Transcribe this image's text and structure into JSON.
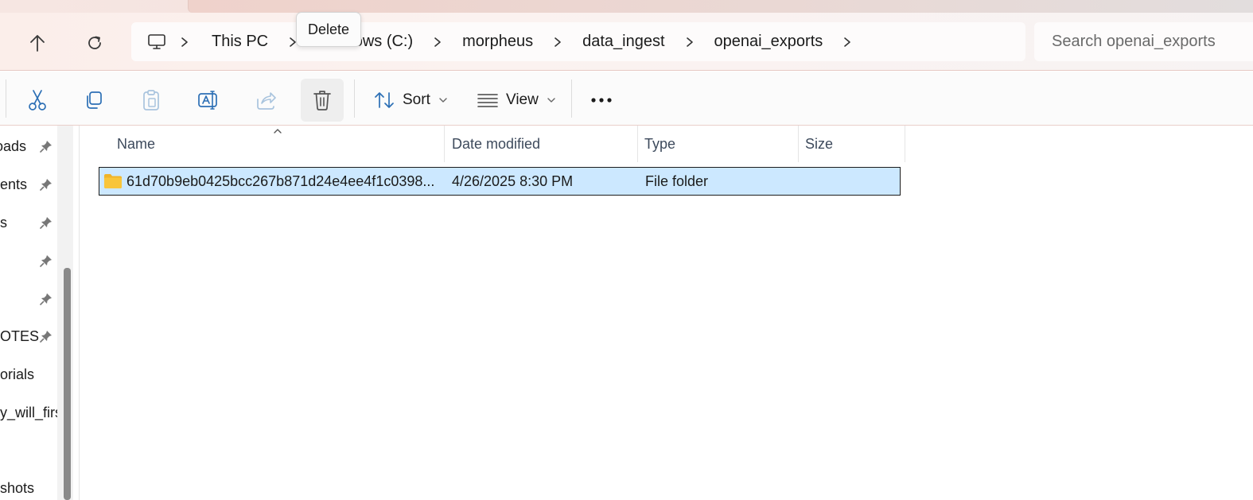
{
  "address_bar": {
    "crumbs": [
      "This PC",
      "Windows (C:)",
      "morpheus",
      "data_ingest",
      "openai_exports"
    ]
  },
  "search": {
    "placeholder": "Search openai_exports"
  },
  "tooltip": {
    "text": "Delete"
  },
  "command_bar": {
    "sort_label": "Sort",
    "view_label": "View"
  },
  "sidebar": {
    "items": [
      {
        "label": "oads",
        "pinned": true
      },
      {
        "label": "ents",
        "pinned": true
      },
      {
        "label": "s",
        "pinned": true
      },
      {
        "label": "",
        "pinned": true
      },
      {
        "label": "",
        "pinned": true
      },
      {
        "label": "OTES",
        "pinned": true
      },
      {
        "label": "orials",
        "pinned": false
      },
      {
        "label": "y_will_first",
        "pinned": false
      },
      {
        "label": "",
        "pinned": false
      },
      {
        "label": "shots",
        "pinned": false
      }
    ]
  },
  "file_list": {
    "columns": [
      "Name",
      "Date modified",
      "Type",
      "Size"
    ],
    "rows": [
      {
        "name": "61d70b9eb0425bcc267b871d24e4ee4f1c0398...",
        "date_modified": "4/26/2025 8:30 PM",
        "type": "File folder",
        "size": "",
        "selected": true
      }
    ]
  },
  "colors": {
    "selection_fill": "#cce8ff",
    "accent": "#0067c0",
    "folder": "#f8c53a"
  }
}
